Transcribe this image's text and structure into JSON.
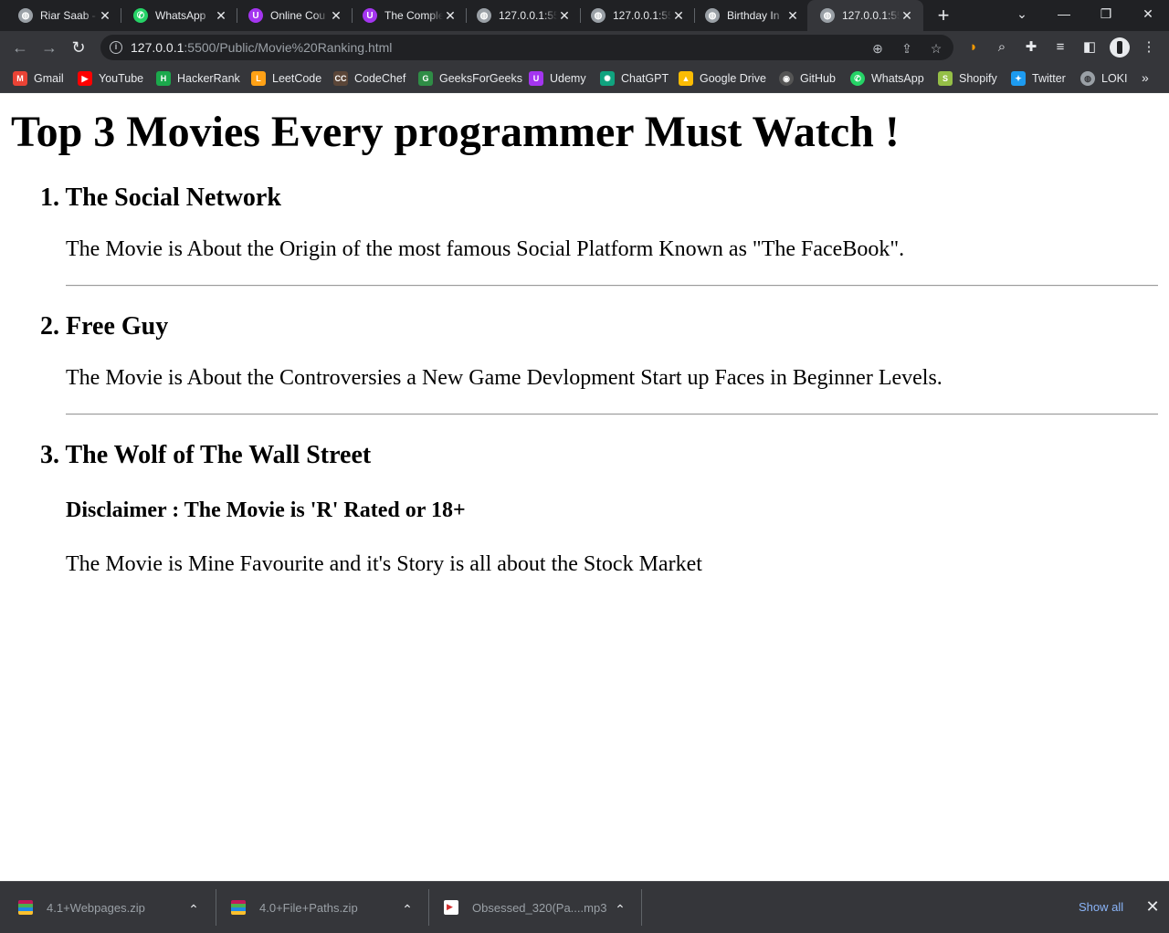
{
  "browser": {
    "tabs": [
      {
        "title": "Riar Saab - ",
        "icon": "globe-icon",
        "active": false
      },
      {
        "title": "WhatsApp",
        "icon": "whatsapp-icon",
        "active": false
      },
      {
        "title": "Online Cou",
        "icon": "udemy-icon",
        "active": false
      },
      {
        "title": "The Comple",
        "icon": "udemy-icon",
        "active": false
      },
      {
        "title": "127.0.0.1:55",
        "icon": "globe-icon",
        "active": false
      },
      {
        "title": "127.0.0.1:55",
        "icon": "globe-icon",
        "active": false
      },
      {
        "title": "Birthday In",
        "icon": "globe-icon",
        "active": false
      },
      {
        "title": "127.0.0.1:55",
        "icon": "globe-icon",
        "active": true
      }
    ],
    "new_tab_glyph": "+",
    "window_controls": {
      "dropdown": "⌄",
      "minimize": "—",
      "restore": "❐",
      "close": "✕"
    },
    "toolbar": {
      "back": "←",
      "forward": "→",
      "reload": "↻",
      "url_host": "127.0.0.1",
      "url_rest": ":5500/Public/Movie%20Ranking.html"
    },
    "bookmarks": [
      {
        "label": "Gmail",
        "icon": "gmail-icon",
        "color": "#ea4335",
        "glyph": "M"
      },
      {
        "label": "YouTube",
        "icon": "youtube-icon",
        "color": "#ff0000",
        "glyph": "▶"
      },
      {
        "label": "HackerRank",
        "icon": "hackerrank-icon",
        "color": "#1ba94c",
        "glyph": "H"
      },
      {
        "label": "LeetCode",
        "icon": "leetcode-icon",
        "color": "#ffa116",
        "glyph": "L"
      },
      {
        "label": "CodeChef",
        "icon": "codechef-icon",
        "color": "#5b4638",
        "glyph": "CC"
      },
      {
        "label": "GeeksForGeeks",
        "icon": "gfg-icon",
        "color": "#2f8d46",
        "glyph": "G"
      },
      {
        "label": "Udemy",
        "icon": "udemy-icon",
        "color": "#a435f0",
        "glyph": "U"
      },
      {
        "label": "ChatGPT",
        "icon": "chatgpt-icon",
        "color": "#10a37f",
        "glyph": "✺"
      },
      {
        "label": "Google Drive",
        "icon": "google-drive-icon",
        "color": "#fbbc04",
        "glyph": "▲"
      },
      {
        "label": "GitHub",
        "icon": "github-icon",
        "color": "#555555",
        "glyph": "◉"
      },
      {
        "label": "WhatsApp",
        "icon": "whatsapp-icon",
        "color": "#25d366",
        "glyph": "✆"
      },
      {
        "label": "Shopify",
        "icon": "shopify-icon",
        "color": "#95bf47",
        "glyph": "S"
      },
      {
        "label": "Twitter",
        "icon": "twitter-icon",
        "color": "#1d9bf0",
        "glyph": "✦"
      },
      {
        "label": "LOKI",
        "icon": "globe-icon",
        "color": "#9aa0a6",
        "glyph": "◍"
      }
    ],
    "bookmarks_overflow": "»"
  },
  "page": {
    "title": "Top 3 Movies Every programmer Must Watch !",
    "movies": [
      {
        "heading": "1. The Social Network",
        "disclaimer": "",
        "description": "The Movie is About the Origin of the most famous Social Platform Known as \"The FaceBook\"."
      },
      {
        "heading": "2. Free Guy",
        "disclaimer": "",
        "description": "The Movie is About the Controversies a New Game Devlopment Start up Faces in Beginner Levels."
      },
      {
        "heading": "3. The Wolf of The Wall Street",
        "disclaimer": "Disclaimer : The Movie is 'R' Rated or 18+",
        "description": "The Movie is Mine Favourite and it's Story is all about the Stock Market"
      }
    ]
  },
  "downloads": {
    "items": [
      {
        "name": "4.1+Webpages.zip",
        "icon": "zip-file-icon"
      },
      {
        "name": "4.0+File+Paths.zip",
        "icon": "zip-file-icon"
      },
      {
        "name": "Obsessed_320(Pa....mp3",
        "icon": "audio-file-icon"
      }
    ],
    "show_all": "Show all",
    "close_glyph": "✕",
    "chevron_glyph": "⌃"
  }
}
